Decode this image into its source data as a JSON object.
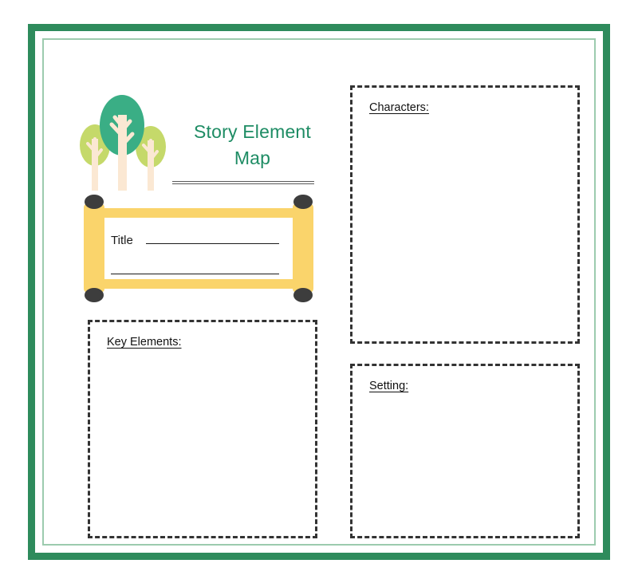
{
  "document": {
    "title": "Story Element Map",
    "type": "worksheet",
    "background_color": "#ffffff"
  },
  "frame": {
    "outer_color": "#2E8B5C",
    "inner_line_color": "#9CCBAE"
  },
  "header": {
    "title_line_1": "Story Element",
    "title_line_2": "Map",
    "title_color": "#1E8C64",
    "divider": "double-rule"
  },
  "illustration": {
    "name": "three-trees",
    "center_tree_color": "#3AAE85",
    "side_tree_color": "#C5D96A",
    "trunk_color": "#FBE8D3",
    "trees": [
      {
        "position": "left",
        "canopy_color": "#C5D96A"
      },
      {
        "position": "center",
        "canopy_color": "#3AAE85"
      },
      {
        "position": "right",
        "canopy_color": "#C5D96A"
      }
    ]
  },
  "title_scroll": {
    "name": "scroll-banner",
    "roller_color": "#FAD46B",
    "knob_color": "#3D3D3D",
    "label": "Title",
    "write_lines": 2
  },
  "sections": [
    {
      "id": "characters",
      "label": "Characters:",
      "value": "",
      "border_style": "dashed",
      "border_color": "#333333"
    },
    {
      "id": "key_elements",
      "label": "Key Elements:",
      "value": "",
      "border_style": "dashed",
      "border_color": "#333333"
    },
    {
      "id": "setting",
      "label": "Setting:",
      "value": "",
      "border_style": "dashed",
      "border_color": "#333333"
    }
  ]
}
